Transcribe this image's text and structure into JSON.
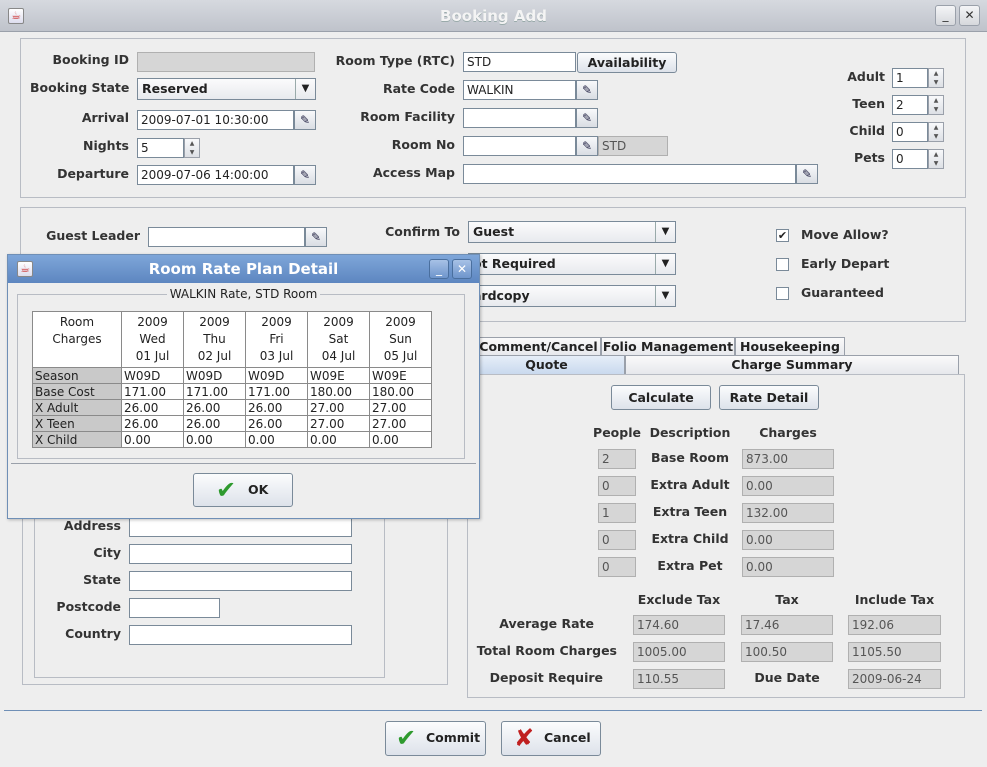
{
  "window": {
    "title": "Booking Add"
  },
  "booking": {
    "booking_id_label": "Booking ID",
    "booking_id": "",
    "state_label": "Booking State",
    "state": "Reserved",
    "arrival_label": "Arrival",
    "arrival": "2009-07-01 10:30:00",
    "nights_label": "Nights",
    "nights": "5",
    "departure_label": "Departure",
    "departure": "2009-07-06 14:00:00",
    "room_type_label": "Room Type (RTC)",
    "room_type": "STD",
    "availability_btn": "Availability",
    "rate_code_label": "Rate Code",
    "rate_code": "WALKIN",
    "room_facility_label": "Room Facility",
    "room_facility": "",
    "room_no_label": "Room No",
    "room_no": "",
    "room_no_type": "STD",
    "access_map_label": "Access Map",
    "access_map": "",
    "adult_label": "Adult",
    "adult": "1",
    "teen_label": "Teen",
    "teen": "2",
    "child_label": "Child",
    "child": "0",
    "pets_label": "Pets",
    "pets": "0"
  },
  "guest": {
    "leader_label": "Guest Leader",
    "leader": "",
    "confirm_label": "Confirm To",
    "confirm": "Guest",
    "combo2": "ot Required",
    "combo3": "ardcopy",
    "move_allow": "Move Allow?",
    "early_depart": "Early Depart",
    "guaranteed": "Guaranteed",
    "address_label": "Address",
    "city_label": "City",
    "state_label": "State",
    "postcode_label": "Postcode",
    "country_label": "Country"
  },
  "tabs": {
    "comment": "Comment/Cancel",
    "folio": "Folio Management",
    "housekeeping": "Housekeeping",
    "quote": "Quote",
    "charge_summary": "Charge Summary"
  },
  "quote": {
    "calculate": "Calculate",
    "rate_detail": "Rate Detail",
    "h_people": "People",
    "h_desc": "Description",
    "h_charges": "Charges",
    "rows": [
      {
        "people": "2",
        "desc": "Base Room",
        "charge": "873.00"
      },
      {
        "people": "0",
        "desc": "Extra Adult",
        "charge": "0.00"
      },
      {
        "people": "1",
        "desc": "Extra Teen",
        "charge": "132.00"
      },
      {
        "people": "0",
        "desc": "Extra Child",
        "charge": "0.00"
      },
      {
        "people": "0",
        "desc": "Extra Pet",
        "charge": "0.00"
      }
    ],
    "h_excl": "Exclude Tax",
    "h_tax": "Tax",
    "h_incl": "Include Tax",
    "avg_label": "Average Rate",
    "avg_excl": "174.60",
    "avg_tax": "17.46",
    "avg_incl": "192.06",
    "total_label": "Total Room Charges",
    "total_excl": "1005.00",
    "total_tax": "100.50",
    "total_incl": "1105.50",
    "deposit_label": "Deposit Require",
    "deposit": "110.55",
    "due_label": "Due Date",
    "due_date": "2009-06-24"
  },
  "footer": {
    "commit": "Commit",
    "cancel": "Cancel"
  },
  "dialog": {
    "title": "Room Rate Plan Detail",
    "group_title": "WALKIN Rate, STD Room",
    "corner": [
      "Room",
      "Charges"
    ],
    "columns": [
      {
        "year": "2009",
        "day": "Wed",
        "date": "01 Jul"
      },
      {
        "year": "2009",
        "day": "Thu",
        "date": "02 Jul"
      },
      {
        "year": "2009",
        "day": "Fri",
        "date": "03 Jul"
      },
      {
        "year": "2009",
        "day": "Sat",
        "date": "04 Jul"
      },
      {
        "year": "2009",
        "day": "Sun",
        "date": "05 Jul"
      }
    ],
    "rows": [
      {
        "label": "Season",
        "values": [
          "W09D",
          "W09D",
          "W09D",
          "W09E",
          "W09E"
        ]
      },
      {
        "label": "Base Cost",
        "values": [
          "171.00",
          "171.00",
          "171.00",
          "180.00",
          "180.00"
        ]
      },
      {
        "label": "X Adult",
        "values": [
          "26.00",
          "26.00",
          "26.00",
          "27.00",
          "27.00"
        ]
      },
      {
        "label": "X Teen",
        "values": [
          "26.00",
          "26.00",
          "26.00",
          "27.00",
          "27.00"
        ]
      },
      {
        "label": "X Child",
        "values": [
          "0.00",
          "0.00",
          "0.00",
          "0.00",
          "0.00"
        ]
      }
    ],
    "ok": "OK"
  }
}
